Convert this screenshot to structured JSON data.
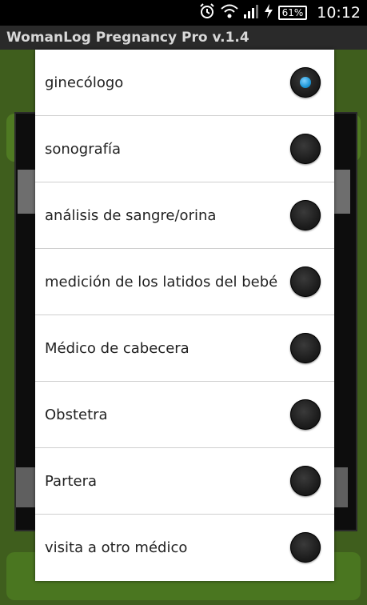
{
  "status_bar": {
    "time": "10:12",
    "battery_percent": "61%",
    "icons": [
      "alarm-icon",
      "wifi-icon",
      "signal-icon",
      "charging-icon",
      "battery-icon"
    ]
  },
  "app": {
    "title": "WomanLog Pregnancy Pro v.1.4",
    "accent_color": "#1e98d8",
    "background_color": "#3f5e1d"
  },
  "dialog": {
    "options": [
      {
        "label": "ginecólogo",
        "selected": true
      },
      {
        "label": "sonografía",
        "selected": false
      },
      {
        "label": "análisis de sangre/orina",
        "selected": false
      },
      {
        "label": "medición de los latidos del bebé",
        "selected": false
      },
      {
        "label": "Médico de cabecera",
        "selected": false
      },
      {
        "label": "Obstetra",
        "selected": false
      },
      {
        "label": "Partera",
        "selected": false
      },
      {
        "label": "visita a otro médico",
        "selected": false
      }
    ]
  }
}
